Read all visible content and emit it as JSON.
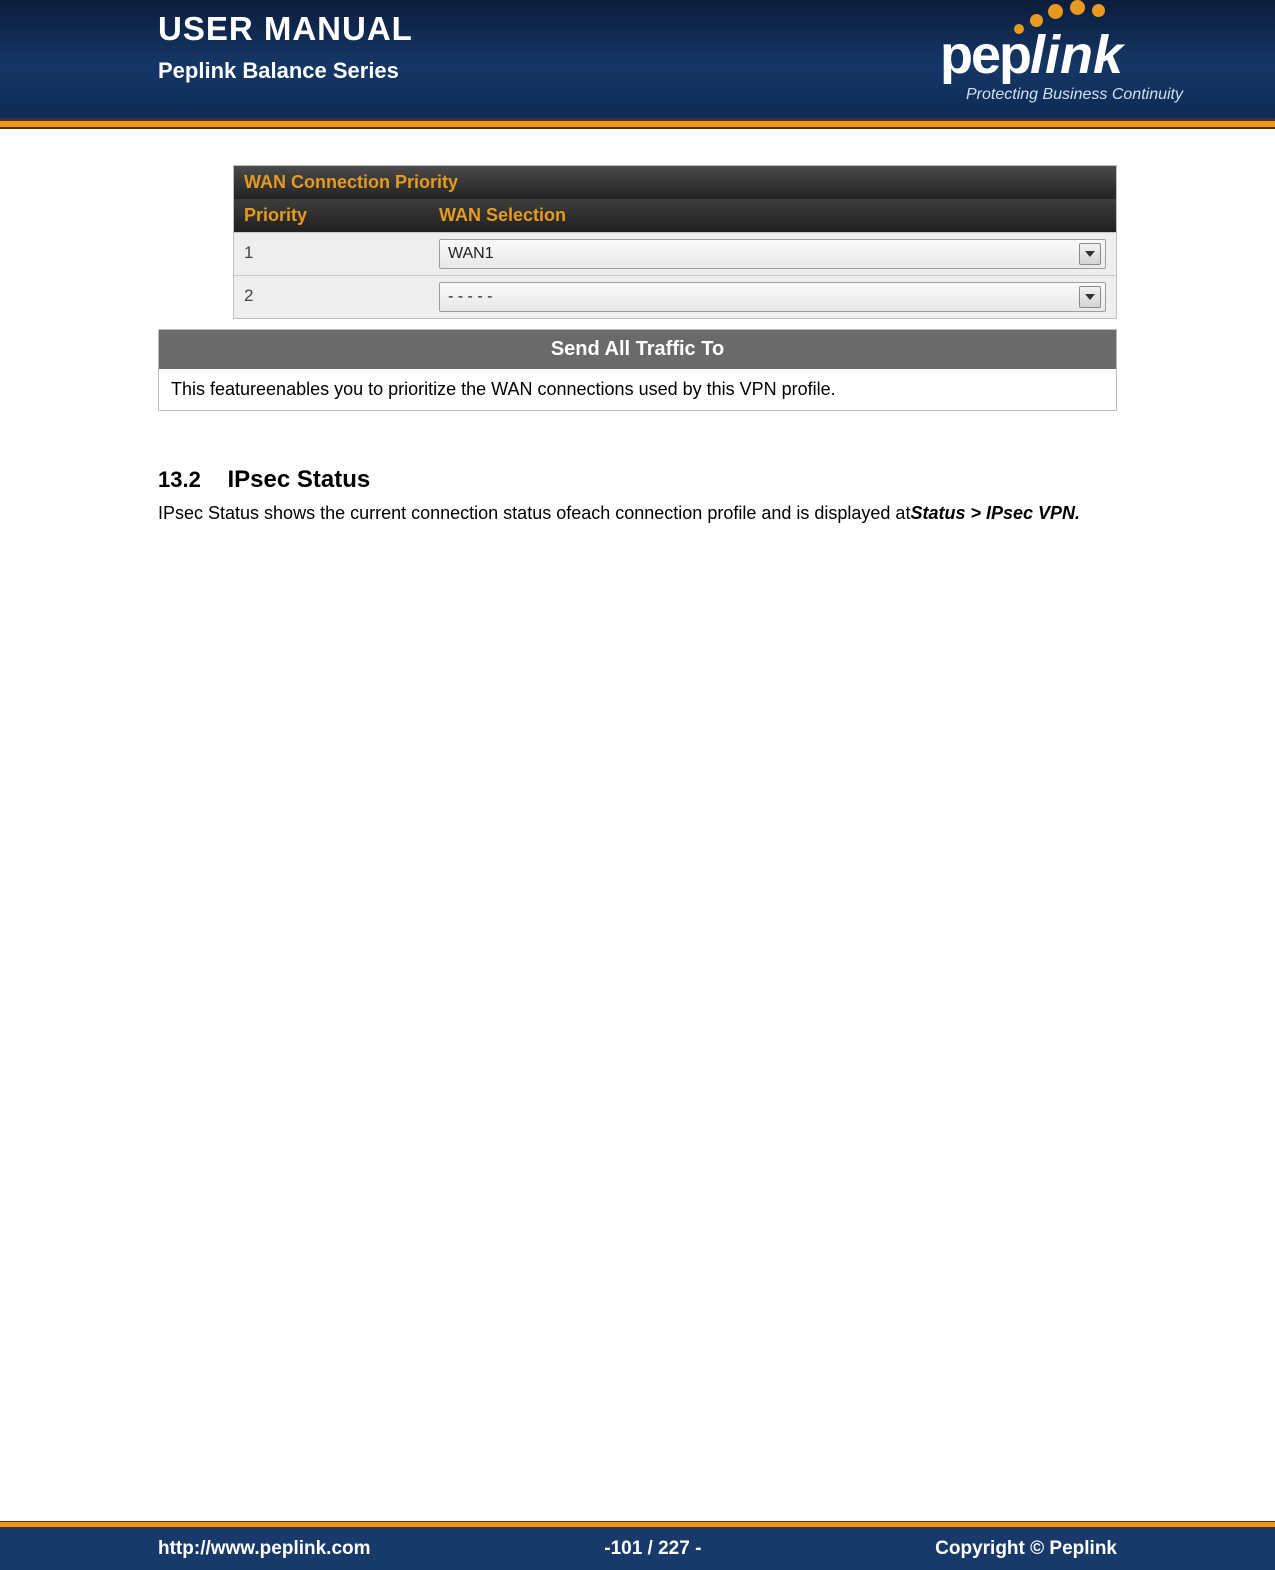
{
  "header": {
    "title": "USER MANUAL",
    "subtitle": "Peplink Balance Series",
    "logo_brand_part1": "pep",
    "logo_brand_part2": "link",
    "logo_tagline": "Protecting Business Continuity"
  },
  "wan_priority": {
    "title": "WAN Connection Priority",
    "columns": {
      "priority": "Priority",
      "wan": "WAN Selection"
    },
    "rows": [
      {
        "priority": "1",
        "selection": "WAN1"
      },
      {
        "priority": "2",
        "selection": "- - - - -"
      }
    ]
  },
  "send_all_traffic": {
    "title": "Send All Traffic To",
    "body": "This featureenables you to prioritize the WAN connections used by this VPN profile."
  },
  "section": {
    "number": "13.2",
    "title": "IPsec Status",
    "para_plain": "IPsec Status shows the current connection status ofeach connection profile and is displayed at",
    "para_strong": "Status > IPsec VPN."
  },
  "footer": {
    "url": "http://www.peplink.com",
    "pager": "-101 / 227 -",
    "copyright": "Copyright ©  Peplink"
  }
}
